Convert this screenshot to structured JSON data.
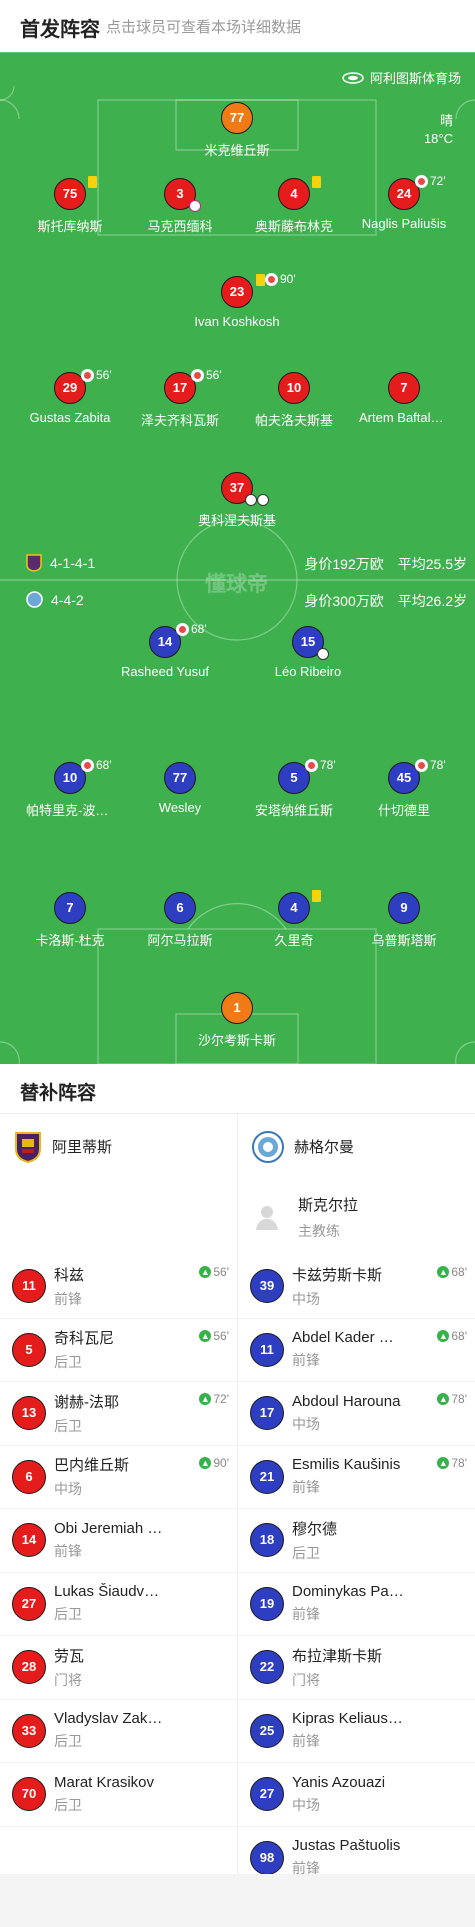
{
  "header": {
    "title": "首发阵容",
    "subtitle": "点击球员可查看本场详细数据"
  },
  "pitch": {
    "venue": "阿利图斯体育场",
    "weather": "晴",
    "temperature": "18°C",
    "watermark": "懂球帝",
    "home": {
      "formation": "4-1-4-1",
      "value": "身价192万欧",
      "avg_age": "平均25.5岁"
    },
    "away": {
      "formation": "4-4-2",
      "value": "身价300万欧",
      "avg_age": "平均26.2岁"
    }
  },
  "starters": [
    {
      "num": "77",
      "name": "米克维丘斯",
      "color": "orange"
    },
    {
      "num": "75",
      "name": "斯托库纳斯",
      "color": "red",
      "yellow": true
    },
    {
      "num": "3",
      "name": "马克西缅科",
      "color": "red",
      "goal_pink": true
    },
    {
      "num": "4",
      "name": "奥斯藤布林克",
      "color": "red",
      "yellow": true
    },
    {
      "num": "24",
      "name": "Naglis Paliušis",
      "color": "red",
      "sub_min": "72'"
    },
    {
      "num": "23",
      "name": "Ivan Koshkosh",
      "color": "red",
      "yellow": true,
      "sub_min": "90'"
    },
    {
      "num": "29",
      "name": "Gustas Zabita",
      "color": "red",
      "sub_min": "56'"
    },
    {
      "num": "17",
      "name": "泽夫齐科瓦斯",
      "color": "red",
      "sub_min": "56'"
    },
    {
      "num": "10",
      "name": "帕夫洛夫斯基",
      "color": "red"
    },
    {
      "num": "7",
      "name": "Artem Baftalovskiy",
      "color": "red"
    },
    {
      "num": "37",
      "name": "奥科涅夫斯基",
      "color": "red",
      "goals": 2
    },
    {
      "num": "14",
      "name": "Rasheed Yusuf",
      "color": "blue",
      "sub_min": "68'"
    },
    {
      "num": "15",
      "name": "Léo Ribeiro",
      "color": "blue",
      "goals": 1
    },
    {
      "num": "10",
      "name": "帕特里克-波格丹",
      "color": "blue",
      "sub_min": "68'"
    },
    {
      "num": "77",
      "name": "Wesley",
      "color": "blue"
    },
    {
      "num": "5",
      "name": "安塔纳维丘斯",
      "color": "blue",
      "sub_min": "78'"
    },
    {
      "num": "45",
      "name": "什切德里",
      "color": "blue",
      "sub_min": "78'"
    },
    {
      "num": "7",
      "name": "卡洛斯-杜克",
      "color": "blue"
    },
    {
      "num": "6",
      "name": "阿尔马拉斯",
      "color": "blue"
    },
    {
      "num": "4",
      "name": "久里奇",
      "color": "blue",
      "yellow": true
    },
    {
      "num": "9",
      "name": "乌普斯塔斯",
      "color": "blue"
    },
    {
      "num": "1",
      "name": "沙尔考斯卡斯",
      "color": "orange"
    }
  ],
  "subs_section": {
    "title": "替补阵容",
    "home": {
      "team": "阿里蒂斯",
      "players": [
        {
          "num": "11",
          "name": "科兹",
          "pos": "前锋",
          "in": "56'"
        },
        {
          "num": "5",
          "name": "奇科瓦尼",
          "pos": "后卫",
          "in": "56'"
        },
        {
          "num": "13",
          "name": "谢赫-法耶",
          "pos": "后卫",
          "in": "72'"
        },
        {
          "num": "6",
          "name": "巴内维丘斯",
          "pos": "中场",
          "in": "90'"
        },
        {
          "num": "14",
          "name": "Obi Jeremiah Chinedu",
          "pos": "前锋"
        },
        {
          "num": "27",
          "name": "Lukas Šiaudvytis",
          "pos": "后卫"
        },
        {
          "num": "28",
          "name": "劳瓦",
          "pos": "门将"
        },
        {
          "num": "33",
          "name": "Vladyslav Zakharov",
          "pos": "后卫"
        },
        {
          "num": "70",
          "name": "Marat Krasikov",
          "pos": "后卫"
        }
      ]
    },
    "away": {
      "team": "赫格尔曼",
      "coach_name": "斯克尔拉",
      "coach_role": "主教练",
      "players": [
        {
          "num": "39",
          "name": "卡兹劳斯卡斯",
          "pos": "中场",
          "in": "68'"
        },
        {
          "num": "11",
          "name": "Abdel Kader Njoya",
          "pos": "前锋",
          "in": "68'"
        },
        {
          "num": "17",
          "name": "Abdoul Harouna",
          "pos": "中场",
          "in": "78'"
        },
        {
          "num": "21",
          "name": "Esmilis Kaušinis",
          "pos": "前锋",
          "in": "78'"
        },
        {
          "num": "18",
          "name": "穆尔德",
          "pos": "后卫"
        },
        {
          "num": "19",
          "name": "Dominykas Paulauskas",
          "pos": "前锋"
        },
        {
          "num": "22",
          "name": "布拉津斯卡斯",
          "pos": "门将"
        },
        {
          "num": "25",
          "name": "Kipras Keliauskas",
          "pos": "前锋"
        },
        {
          "num": "27",
          "name": "Yanis Azouazi",
          "pos": "中场"
        },
        {
          "num": "98",
          "name": "Justas Paštuolis",
          "pos": "前锋"
        }
      ]
    }
  },
  "colors": {
    "pitch": "#3eb14e",
    "home": "#e41c1c",
    "away": "#2e3ec0",
    "keeper": "#f07a16",
    "yellow_card": "#f5d20c",
    "sub_in": "#36b24a"
  }
}
